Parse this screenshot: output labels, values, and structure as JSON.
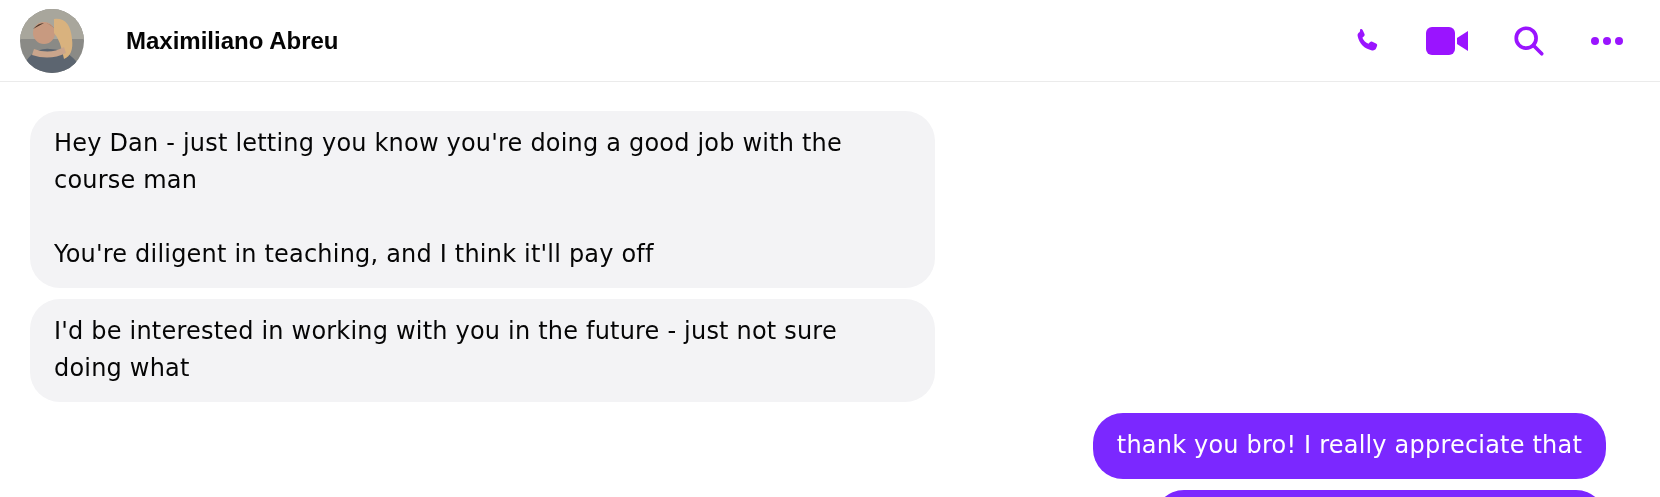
{
  "header": {
    "contact_name": "Maximiliano Abreu",
    "actions": [
      {
        "kind": "phone"
      },
      {
        "kind": "video"
      },
      {
        "kind": "search"
      },
      {
        "kind": "more"
      }
    ]
  },
  "messages": [
    {
      "kind": "incoming",
      "paragraphs": [
        "Hey Dan - just letting you know you're doing a good job with the course man",
        "You're diligent in teaching, and I think it'll pay off"
      ]
    },
    {
      "kind": "incoming",
      "paragraphs": [
        "I'd be interested in working with you in the future - just not sure doing what"
      ]
    },
    {
      "kind": "outgoing",
      "paragraphs": [
        "thank you bro! I really appreciate that"
      ]
    },
    {
      "kind": "outgoing"
    }
  ]
}
